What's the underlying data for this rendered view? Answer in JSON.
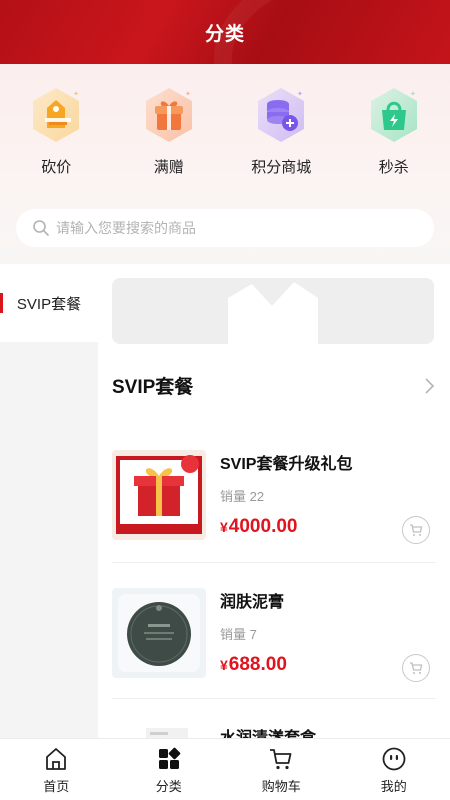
{
  "header": {
    "title": "分类"
  },
  "quick_links": [
    {
      "label": "砍价",
      "icon": "bargain-icon",
      "color": "#f5a623"
    },
    {
      "label": "满赠",
      "icon": "gift-icon",
      "color": "#f2773d"
    },
    {
      "label": "积分商城",
      "icon": "points-coin-icon",
      "color": "#8a6cf0"
    },
    {
      "label": "秒杀",
      "icon": "flash-sale-icon",
      "color": "#2ec88a"
    }
  ],
  "search": {
    "placeholder": "请输入您要搜索的商品"
  },
  "sidebar": {
    "items": [
      {
        "label": "SVIP套餐",
        "active": true
      }
    ]
  },
  "section": {
    "title": "SVIP套餐"
  },
  "products": [
    {
      "name": "SVIP套餐升级礼包",
      "sales": "销量 22",
      "currency": "¥",
      "price": "4000.00"
    },
    {
      "name": "润肤泥膏",
      "sales": "销量 7",
      "currency": "¥",
      "price": "688.00"
    },
    {
      "name": "水润清漾套盒"
    }
  ],
  "tabbar": [
    {
      "label": "首页",
      "icon": "home-icon"
    },
    {
      "label": "分类",
      "icon": "category-icon"
    },
    {
      "label": "购物车",
      "icon": "cart-icon"
    },
    {
      "label": "我的",
      "icon": "profile-icon"
    }
  ],
  "colors": {
    "primary": "#d9161c",
    "header": "#c0141a",
    "price": "#e0141e"
  }
}
